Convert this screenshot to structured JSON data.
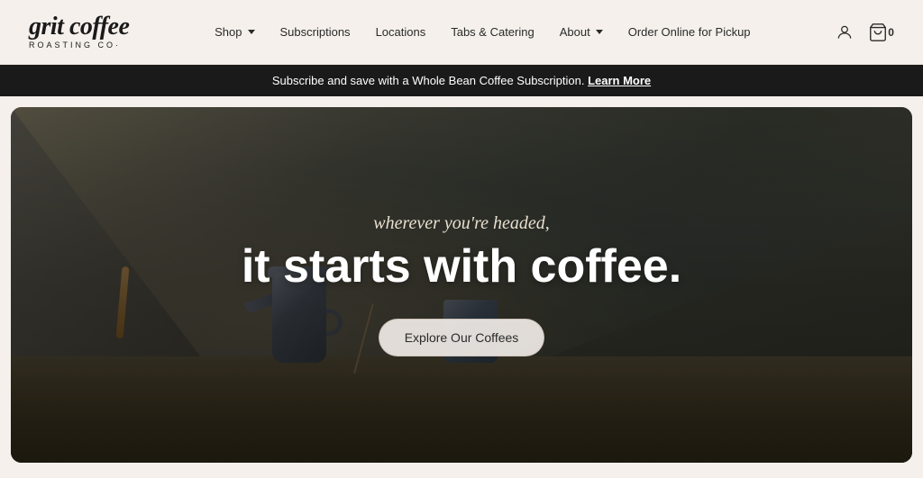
{
  "brand": {
    "name_main": "grit coffee",
    "name_sub": "ROASTING CO·"
  },
  "nav": {
    "items": [
      {
        "id": "shop",
        "label": "Shop",
        "has_dropdown": true
      },
      {
        "id": "subscriptions",
        "label": "Subscriptions",
        "has_dropdown": false
      },
      {
        "id": "locations",
        "label": "Locations",
        "has_dropdown": false
      },
      {
        "id": "tabs-catering",
        "label": "Tabs & Catering",
        "has_dropdown": false
      },
      {
        "id": "about",
        "label": "About",
        "has_dropdown": true
      },
      {
        "id": "order-online",
        "label": "Order Online for Pickup",
        "has_dropdown": false
      }
    ],
    "cart_count": "0"
  },
  "promo_banner": {
    "text": "Subscribe and save with a Whole Bean Coffee Subscription.",
    "link_label": "Learn More"
  },
  "hero": {
    "subtitle": "wherever you're headed,",
    "title": "it starts with coffee.",
    "cta_label": "Explore Our Coffees"
  }
}
